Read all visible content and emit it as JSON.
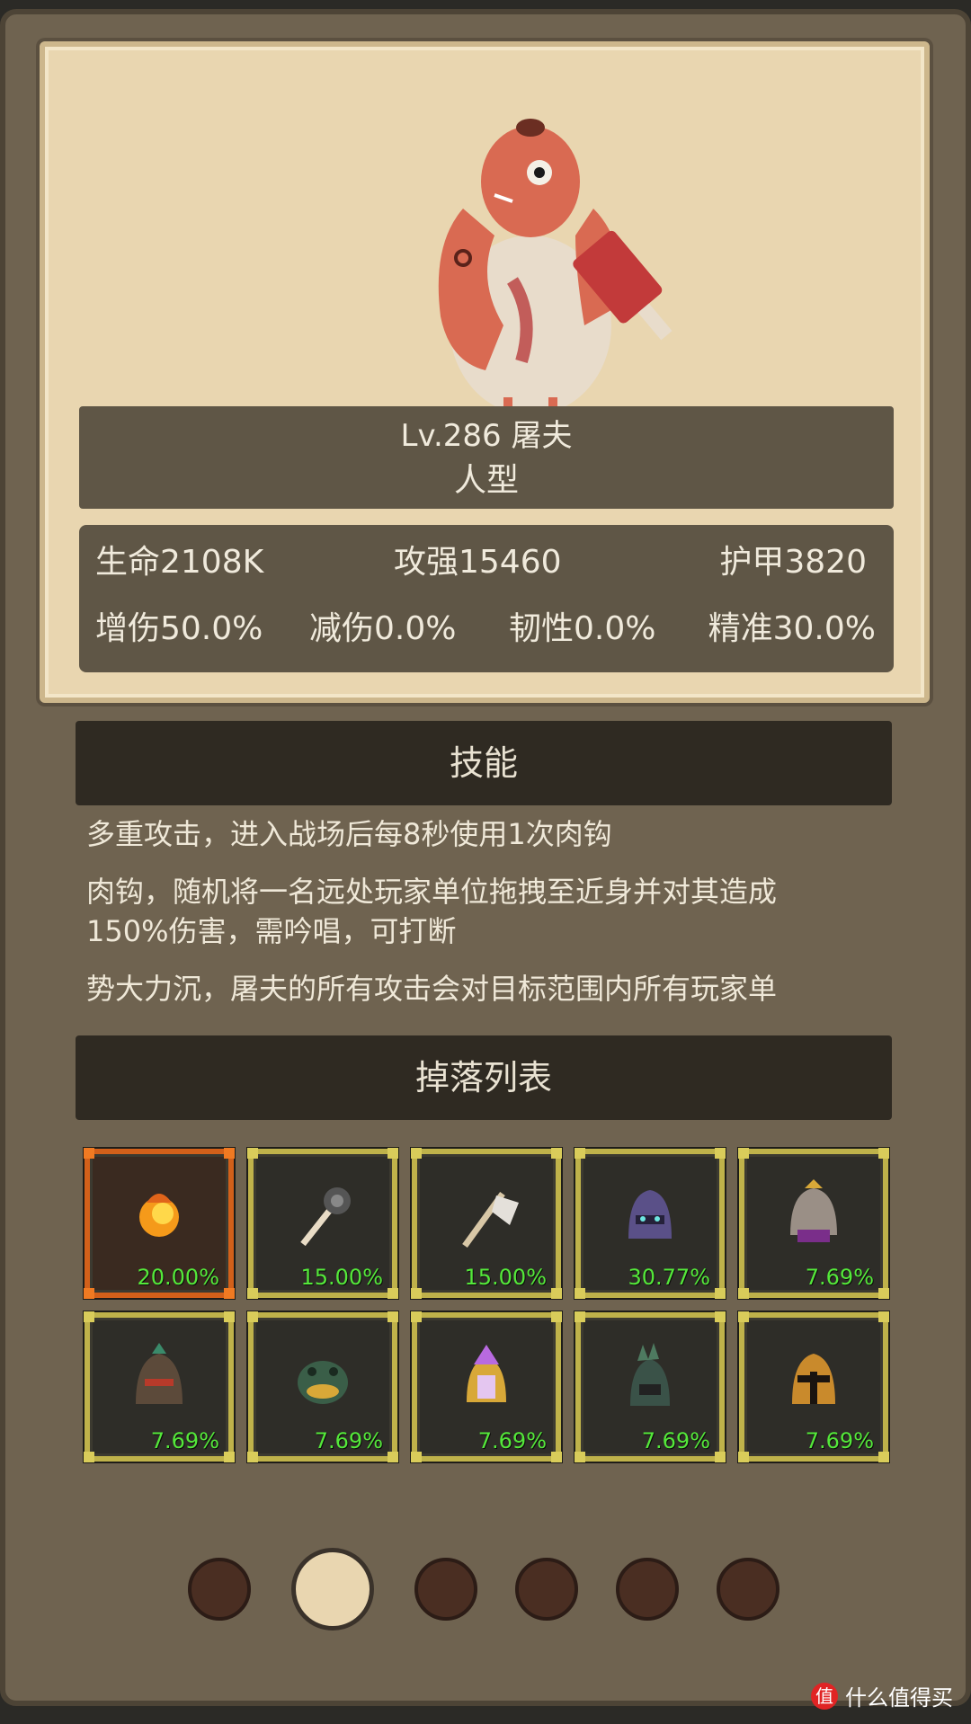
{
  "monster": {
    "name_line": "Lv.286 屠夫",
    "type": "人型"
  },
  "stats": {
    "hp": "生命2108K",
    "attack": "攻强15460",
    "armor": "护甲3820",
    "dmg_up": "增伤50.0%",
    "dmg_down": "减伤0.0%",
    "toughness": "韧性0.0%",
    "accuracy": "精准30.0%"
  },
  "skills": {
    "header": "技能",
    "lines": [
      "多重攻击，进入战场后每8秒使用1次肉钩",
      "肉钩，随机将一名远处玩家单位拖拽至近身并对其造成",
      "150%伤害，需吟唱，可打断",
      "势大力沉，屠夫的所有攻击会对目标范围内所有玩家单"
    ]
  },
  "drops": {
    "header": "掉落列表",
    "items": [
      {
        "icon": "fire-orb-icon",
        "rate": "20.00%",
        "rarity": "orange"
      },
      {
        "icon": "spiked-mace-icon",
        "rate": "15.00%",
        "rarity": "gold"
      },
      {
        "icon": "bone-axe-icon",
        "rate": "15.00%",
        "rarity": "gold"
      },
      {
        "icon": "purple-helmet-icon",
        "rate": "30.77%",
        "rarity": "gold"
      },
      {
        "icon": "gold-purple-helmet-icon",
        "rate": "7.69%",
        "rarity": "gold"
      },
      {
        "icon": "dragon-helmet-icon",
        "rate": "7.69%",
        "rarity": "gold"
      },
      {
        "icon": "green-frog-helmet-icon",
        "rate": "7.69%",
        "rarity": "gold"
      },
      {
        "icon": "crystal-crown-helmet-icon",
        "rate": "7.69%",
        "rarity": "gold"
      },
      {
        "icon": "green-spiked-helmet-icon",
        "rate": "7.69%",
        "rarity": "gold"
      },
      {
        "icon": "gold-spartan-helmet-icon",
        "rate": "7.69%",
        "rarity": "gold"
      }
    ]
  },
  "pager": {
    "count": 6,
    "active": 1
  },
  "watermark": "什么值得买",
  "colors": {
    "drop_rate": "#54e83a",
    "rare_border": "#bfb24a",
    "legendary_border": "#d2601a"
  }
}
